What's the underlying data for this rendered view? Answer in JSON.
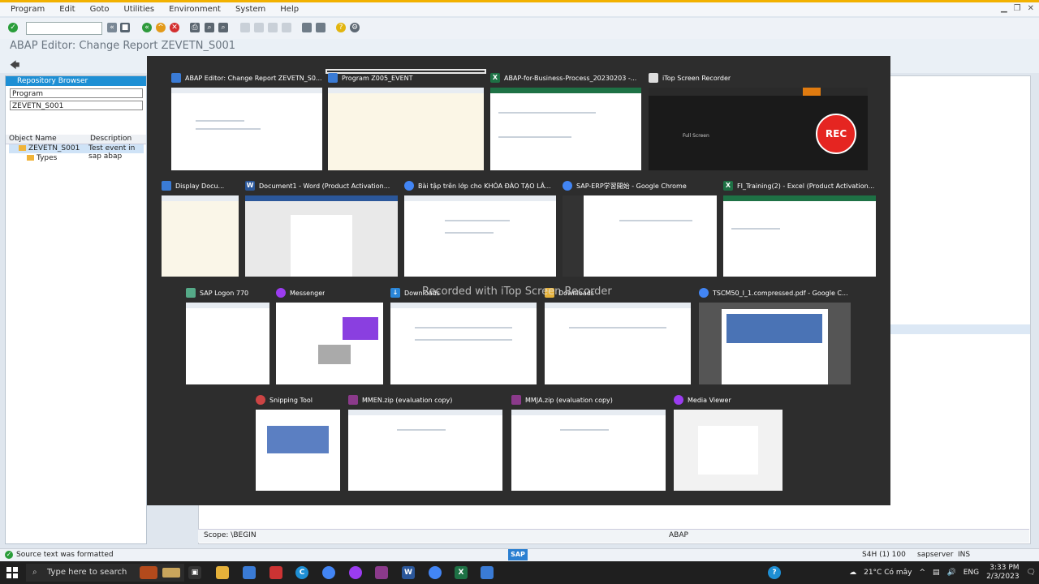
{
  "menu": [
    "Program",
    "Edit",
    "Goto",
    "Utilities",
    "Environment",
    "System",
    "Help"
  ],
  "window_title": "ABAP Editor: Change Report ZEVETN_S001",
  "sidebar": {
    "header": "Repository Browser",
    "object_type": "Program",
    "object_name": "ZEVETN_S001",
    "col_object": "Object Name",
    "col_desc": "Description",
    "tree": [
      {
        "name": "ZEVETN_S001",
        "desc": "Test event in sap abap"
      },
      {
        "name": "Types",
        "desc": ""
      }
    ]
  },
  "editor": {
    "scope": "Scope: \\BEGIN",
    "lang": "ABAP"
  },
  "status": {
    "message": "Source text was formatted",
    "system": "S4H (1) 100",
    "server": "sapserver",
    "mode": "INS"
  },
  "watermark": "Recorded with iTop Screen Recorder",
  "switcher": {
    "windows": [
      {
        "title": "ABAP Editor: Change Report ZEVETN_S0...",
        "icon": "sap-icon",
        "color": "#3a7bd5"
      },
      {
        "title": "Program Z005_EVENT",
        "icon": "sap-icon",
        "color": "#3a7bd5"
      },
      {
        "title": "ABAP-for-Business-Process_20230203 -...",
        "icon": "excel-icon",
        "color": "#1e7145"
      },
      {
        "title": "iTop Screen Recorder",
        "icon": "itop-icon",
        "color": "#d33"
      },
      {
        "title": "Display Docu...",
        "icon": "sap-icon",
        "color": "#3a7bd5"
      },
      {
        "title": "Document1 - Word (Product Activation...",
        "icon": "word-icon",
        "color": "#2b579a"
      },
      {
        "title": "Bài tập trên lớp cho KHÓA ĐÀO TẠO LÂ...",
        "icon": "chrome-icon",
        "color": "#4285f4"
      },
      {
        "title": "SAP-ERP学習開始 - Google Chrome",
        "icon": "chrome-icon",
        "color": "#4285f4"
      },
      {
        "title": "FI_Training(2) - Excel (Product Activation...",
        "icon": "excel-icon",
        "color": "#1e7145"
      },
      {
        "title": "SAP Logon 770",
        "icon": "sap-logon-icon",
        "color": "#5a8"
      },
      {
        "title": "Messenger",
        "icon": "messenger-icon",
        "color": "#9b3cf0"
      },
      {
        "title": "Downloads",
        "icon": "download-icon",
        "color": "#2a86d8"
      },
      {
        "title": "Downloads",
        "icon": "folder-icon",
        "color": "#e5b13a"
      },
      {
        "title": "TSCM50_I_1.compressed.pdf - Google C...",
        "icon": "chrome-icon",
        "color": "#4285f4"
      },
      {
        "title": "Snipping Tool",
        "icon": "snipping-icon",
        "color": "#c44"
      },
      {
        "title": "MMEN.zip (evaluation copy)",
        "icon": "winrar-icon",
        "color": "#8b3a8b"
      },
      {
        "title": "MMJA.zip (evaluation copy)",
        "icon": "winrar-icon",
        "color": "#8b3a8b"
      },
      {
        "title": "Media Viewer",
        "icon": "messenger-icon",
        "color": "#9b3cf0"
      }
    ],
    "recorder": {
      "rec_label": "REC",
      "mode": "Full Screen"
    }
  },
  "taskbar": {
    "search_placeholder": "Type here to search",
    "weather": "21°C  Có mây",
    "lang": "ENG",
    "time": "3:33 PM",
    "date": "2/3/2023"
  }
}
